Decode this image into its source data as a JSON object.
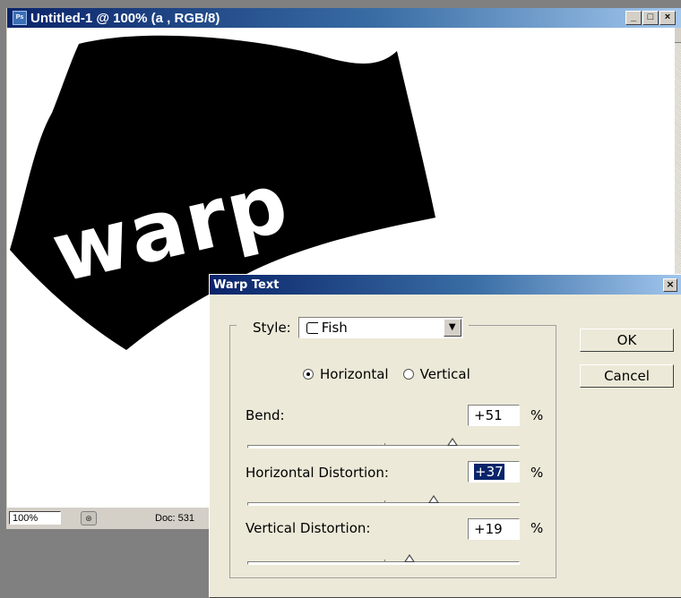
{
  "document_window": {
    "title": "Untitled-1 @ 100% (a , RGB/8)",
    "app_icon": "photoshop-doc-icon",
    "buttons": {
      "minimize": "_",
      "maximize": "□",
      "close": "×"
    }
  },
  "canvas": {
    "warp_text": "warp",
    "colors": {
      "shape": "#000000",
      "text": "#ffffff",
      "background": "#ffffff"
    }
  },
  "status_bar": {
    "zoom": "100%",
    "doc_info": "Doc: 531"
  },
  "dialog": {
    "title": "Warp Text",
    "close_label": "×",
    "style_label": "Style:",
    "style_value": "Fish",
    "style_icon": "fish-icon",
    "orientation_options": [
      "Horizontal",
      "Vertical"
    ],
    "orientation_selected": "Horizontal",
    "bend": {
      "label": "Bend:",
      "value": "+51",
      "unit": "%",
      "percent": 51
    },
    "horizontal_distortion": {
      "label": "Horizontal Distortion:",
      "value": "+37",
      "unit": "%",
      "percent": 37
    },
    "vertical_distortion": {
      "label": "Vertical Distortion:",
      "value": "+19",
      "unit": "%",
      "percent": 19
    },
    "ok_label": "OK",
    "cancel_label": "Cancel"
  }
}
